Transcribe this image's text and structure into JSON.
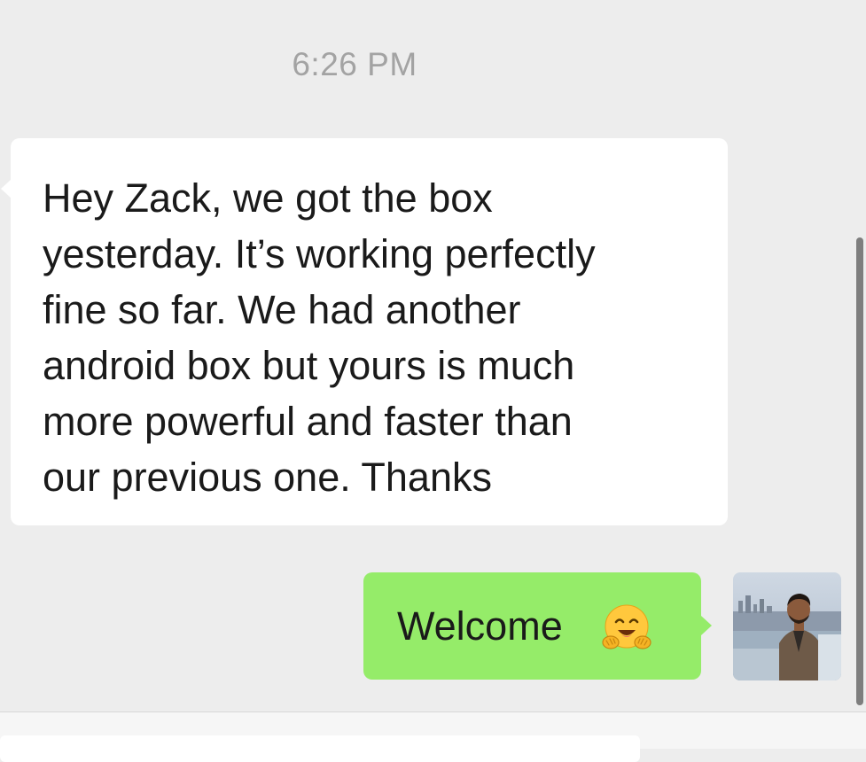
{
  "chat": {
    "timestamp": "6:26 PM",
    "messages": [
      {
        "direction": "incoming",
        "text": "Hey Zack, we got the box\nyesterday. It’s working perfectly\nfine so far. We had another\nandroid box but yours is much\nmore powerful and faster than\nour previous one. Thanks"
      },
      {
        "direction": "outgoing",
        "text": "Welcome",
        "emoji": "hugging-face-icon"
      }
    ]
  },
  "colors": {
    "background": "#ededed",
    "incoming_bubble": "#ffffff",
    "outgoing_bubble": "#95ec69",
    "timestamp": "#a3a3a3",
    "text": "#1a1a1a"
  },
  "icons": {
    "avatar": "user-avatar-photo",
    "emoji": "hugging-face-icon"
  }
}
